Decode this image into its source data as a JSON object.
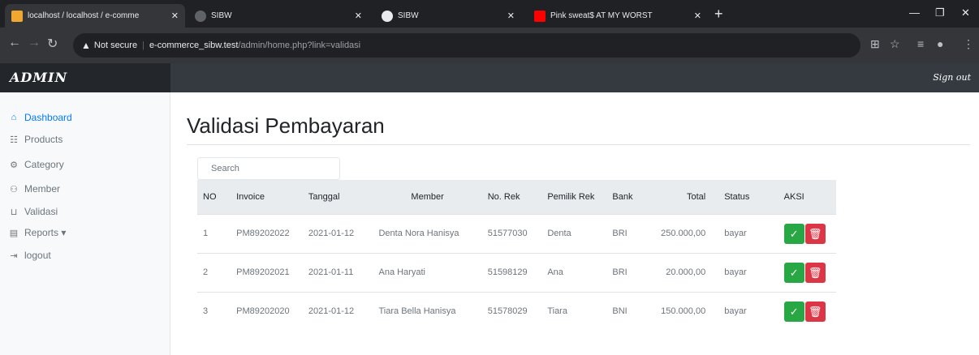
{
  "browser": {
    "tabs": [
      {
        "title": "localhost / localhost / e-comme",
        "active": true
      },
      {
        "title": "SIBW",
        "active": false
      },
      {
        "title": "SIBW",
        "active": false
      },
      {
        "title": "Pink sweat$ AT MY WORST",
        "active": false
      }
    ],
    "address": {
      "security_label": "Not secure",
      "host": "e-commerce_sibw.test",
      "path": "/admin/home.php?link=validasi"
    }
  },
  "app": {
    "brand": "ADMIN",
    "signout_label": "Sign out"
  },
  "sidebar": {
    "items": [
      {
        "label": "Dashboard",
        "icon": "home-icon",
        "active": true
      },
      {
        "label": "Products",
        "icon": "list-icon",
        "active": false
      },
      {
        "label": "Category",
        "icon": "gear-icon",
        "active": false
      },
      {
        "label": "Member",
        "icon": "users-icon",
        "active": false
      },
      {
        "label": "Validasi",
        "icon": "cart-icon",
        "active": false
      },
      {
        "label": "Reports ▾",
        "icon": "file-icon",
        "active": false
      },
      {
        "label": "logout",
        "icon": "logout-icon",
        "active": false
      }
    ]
  },
  "main": {
    "title": "Validasi Pembayaran",
    "search_placeholder": "Search",
    "table": {
      "headers": [
        "NO",
        "Invoice",
        "Tanggal",
        "Member",
        "No. Rek",
        "Pemilik Rek",
        "Bank",
        "Total",
        "Status",
        "AKSI"
      ],
      "rows": [
        {
          "no": "1",
          "invoice": "PM89202022",
          "tanggal": "2021-01-12",
          "member": "Denta Nora Hanisya",
          "no_rek": "51577030",
          "pemilik": "Denta",
          "bank": "BRI",
          "total": "250.000,00",
          "status": "bayar"
        },
        {
          "no": "2",
          "invoice": "PM89202021",
          "tanggal": "2021-01-11",
          "member": "Ana Haryati",
          "no_rek": "51598129",
          "pemilik": "Ana",
          "bank": "BRI",
          "total": "20.000,00",
          "status": "bayar"
        },
        {
          "no": "3",
          "invoice": "PM89202020",
          "tanggal": "2021-01-12",
          "member": "Tiara Bella Hanisya",
          "no_rek": "51578029",
          "pemilik": "Tiara",
          "bank": "BNI",
          "total": "150.000,00",
          "status": "bayar"
        }
      ]
    }
  },
  "colors": {
    "accent": "#007bff",
    "approve": "#28a745",
    "delete": "#dc3545",
    "header": "#343a40"
  }
}
